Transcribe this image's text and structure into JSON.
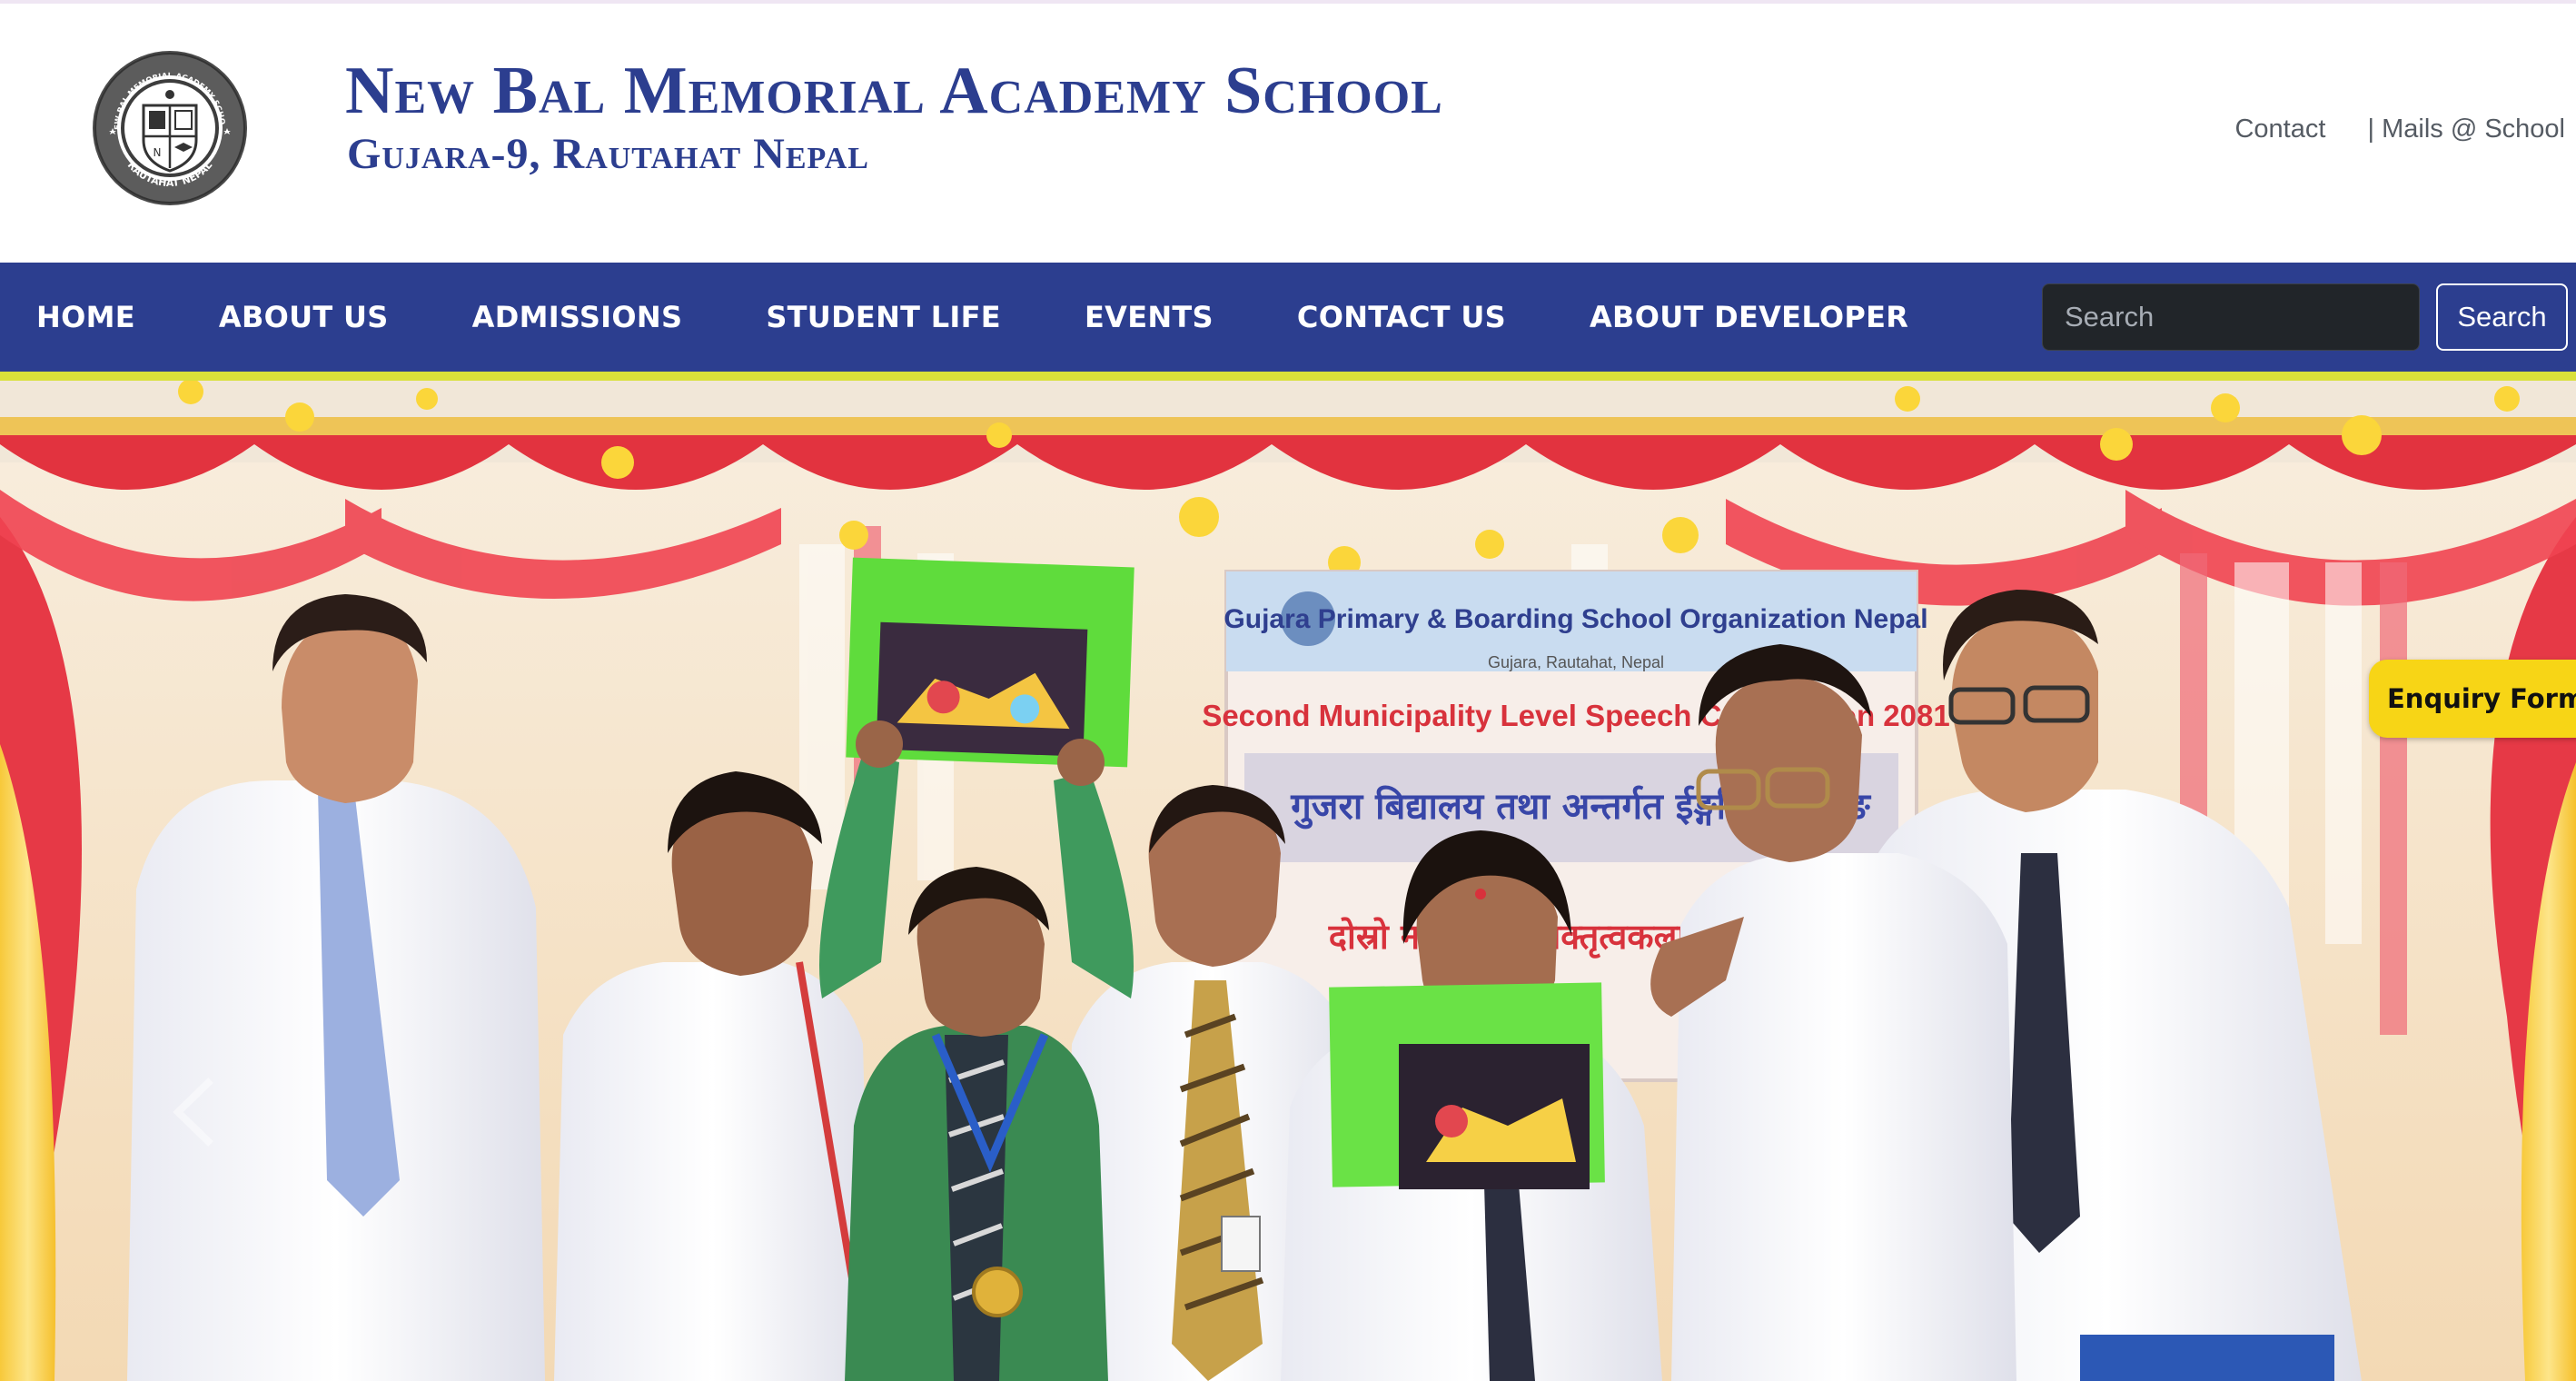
{
  "header": {
    "school_name": "New Bal Memorial Academy School",
    "address": "Gujara-9, Rautahat Nepal",
    "logo_text_top": "NEW BAL MEMORIAL ACADEMY SCHOOL",
    "logo_text_bottom": "RAUTAHAT NEPAL",
    "logo_icon": "school-crest-icon",
    "links": [
      {
        "label": "Contact"
      },
      {
        "label": "| Mails @ School"
      }
    ]
  },
  "nav": {
    "items": [
      {
        "label": "HOME"
      },
      {
        "label": "ABOUT US"
      },
      {
        "label": "ADMISSIONS"
      },
      {
        "label": "STUDENT LIFE"
      },
      {
        "label": "EVENTS"
      },
      {
        "label": "CONTACT US"
      },
      {
        "label": "ABOUT DEVELOPER"
      }
    ],
    "search_placeholder": "Search",
    "search_button": "Search"
  },
  "hero": {
    "banner_line1": "Gujara Primary & Boarding School Organization Nepal",
    "banner_line2": "Gujara, Rautahat, Nepal",
    "banner_line3": "Second Municipality Level Speech Competition 2081",
    "banner_line4": "गुजरा बिद्यालय तथा अन्तर्गत ईङ्गलिश बोर्डिङ",
    "banner_line5": "दोस्रो नगरस्तरीय वक्तृत्वकला प्रतियोगिता",
    "prev_icon": "chevron-left-icon"
  },
  "enquiry": {
    "label": "Enquiry Form"
  },
  "colors": {
    "brand_blue": "#2c3e8f",
    "accent_yellow": "#d9e03a",
    "enquiry_yellow": "#f7d516",
    "search_field_bg": "#212529"
  }
}
